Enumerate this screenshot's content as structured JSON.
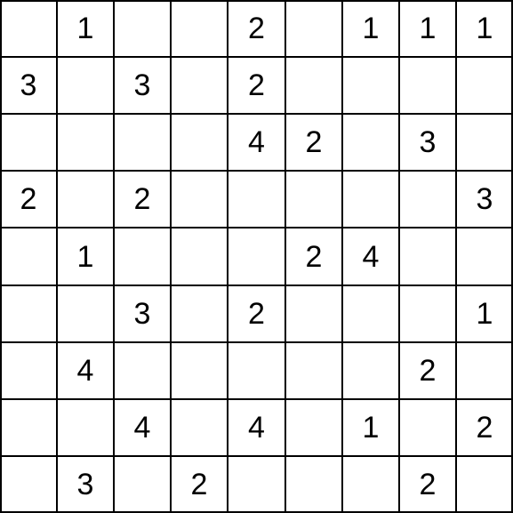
{
  "grid": {
    "rows": 9,
    "cols": 9,
    "cells": [
      [
        null,
        "1",
        null,
        null,
        "2",
        null,
        "1",
        "1",
        "1"
      ],
      [
        "3",
        null,
        "3",
        null,
        "2",
        null,
        null,
        null,
        null
      ],
      [
        null,
        null,
        null,
        null,
        "4",
        "2",
        null,
        "3",
        null
      ],
      [
        "2",
        null,
        "2",
        null,
        null,
        null,
        null,
        null,
        "3"
      ],
      [
        null,
        "1",
        null,
        null,
        null,
        "2",
        "4",
        null,
        null
      ],
      [
        null,
        null,
        "3",
        null,
        "2",
        null,
        null,
        null,
        "1"
      ],
      [
        null,
        "4",
        null,
        null,
        null,
        null,
        null,
        "2",
        null
      ],
      [
        null,
        null,
        "4",
        null,
        "4",
        null,
        "1",
        null,
        "2"
      ],
      [
        null,
        "3",
        null,
        "2",
        null,
        null,
        null,
        "2",
        null
      ]
    ]
  },
  "chart_data": {
    "type": "table",
    "title": "",
    "rows": 9,
    "cols": 9,
    "values": [
      [
        null,
        1,
        null,
        null,
        2,
        null,
        1,
        1,
        1
      ],
      [
        3,
        null,
        3,
        null,
        2,
        null,
        null,
        null,
        null
      ],
      [
        null,
        null,
        null,
        null,
        4,
        2,
        null,
        3,
        null
      ],
      [
        2,
        null,
        2,
        null,
        null,
        null,
        null,
        null,
        3
      ],
      [
        null,
        1,
        null,
        null,
        null,
        2,
        4,
        null,
        null
      ],
      [
        null,
        null,
        3,
        null,
        2,
        null,
        null,
        null,
        1
      ],
      [
        null,
        4,
        null,
        null,
        null,
        null,
        null,
        2,
        null
      ],
      [
        null,
        null,
        4,
        null,
        4,
        null,
        1,
        null,
        2
      ],
      [
        null,
        3,
        null,
        2,
        null,
        null,
        null,
        2,
        null
      ]
    ]
  }
}
